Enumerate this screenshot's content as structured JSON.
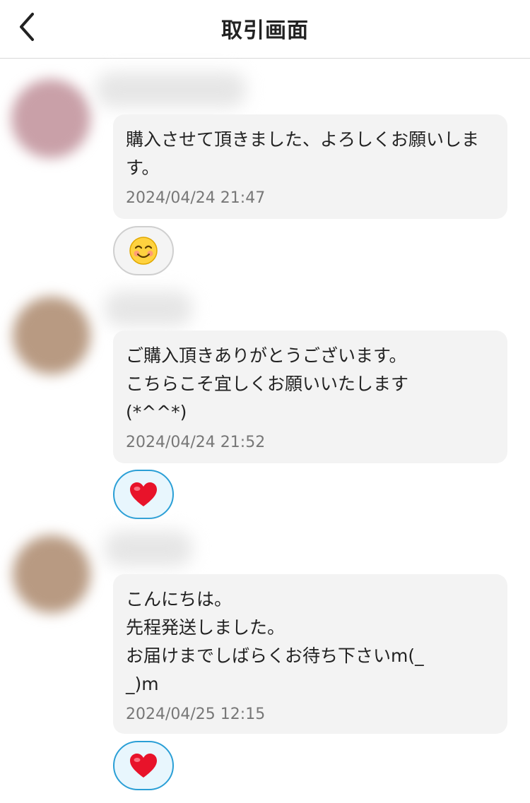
{
  "header": {
    "title": "取引画面",
    "back_icon": "chevron-left-icon"
  },
  "messages": [
    {
      "text": "購入させて頂きました、よろしくお願いします。",
      "timestamp": "2024/04/24 21:47",
      "reaction": "smile-emoji-icon",
      "avatar_color": "#c9a0a8"
    },
    {
      "text": "ご購入頂きありがとうございます。\nこちらこそ宜しくお願いいたします\n(*^^*)",
      "timestamp": "2024/04/24 21:52",
      "reaction": "heart-emoji-icon",
      "avatar_color": "#b89a82"
    },
    {
      "text": "こんにちは。\n先程発送しました。\nお届けまでしばらくお待ち下さいm(_\n_)m",
      "timestamp": "2024/04/25 12:15",
      "reaction": "heart-emoji-icon",
      "avatar_color": "#b89a82"
    }
  ]
}
